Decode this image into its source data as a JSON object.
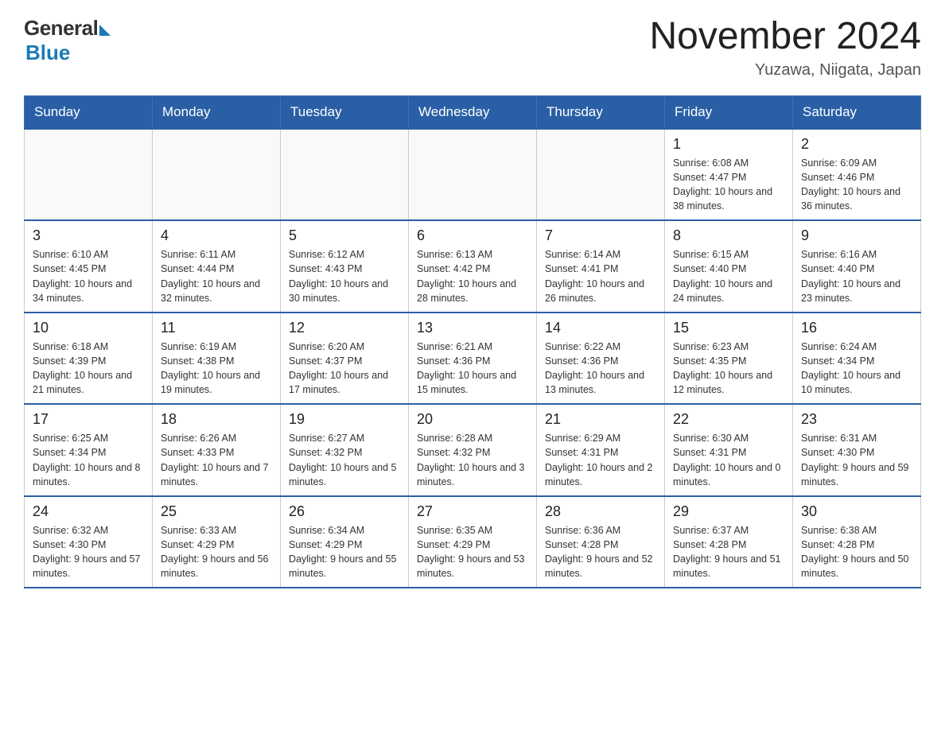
{
  "header": {
    "logo": {
      "general": "General",
      "blue": "Blue"
    },
    "title": "November 2024",
    "location": "Yuzawa, Niigata, Japan"
  },
  "weekdays": [
    "Sunday",
    "Monday",
    "Tuesday",
    "Wednesday",
    "Thursday",
    "Friday",
    "Saturday"
  ],
  "weeks": [
    [
      {
        "day": "",
        "info": ""
      },
      {
        "day": "",
        "info": ""
      },
      {
        "day": "",
        "info": ""
      },
      {
        "day": "",
        "info": ""
      },
      {
        "day": "",
        "info": ""
      },
      {
        "day": "1",
        "info": "Sunrise: 6:08 AM\nSunset: 4:47 PM\nDaylight: 10 hours and 38 minutes."
      },
      {
        "day": "2",
        "info": "Sunrise: 6:09 AM\nSunset: 4:46 PM\nDaylight: 10 hours and 36 minutes."
      }
    ],
    [
      {
        "day": "3",
        "info": "Sunrise: 6:10 AM\nSunset: 4:45 PM\nDaylight: 10 hours and 34 minutes."
      },
      {
        "day": "4",
        "info": "Sunrise: 6:11 AM\nSunset: 4:44 PM\nDaylight: 10 hours and 32 minutes."
      },
      {
        "day": "5",
        "info": "Sunrise: 6:12 AM\nSunset: 4:43 PM\nDaylight: 10 hours and 30 minutes."
      },
      {
        "day": "6",
        "info": "Sunrise: 6:13 AM\nSunset: 4:42 PM\nDaylight: 10 hours and 28 minutes."
      },
      {
        "day": "7",
        "info": "Sunrise: 6:14 AM\nSunset: 4:41 PM\nDaylight: 10 hours and 26 minutes."
      },
      {
        "day": "8",
        "info": "Sunrise: 6:15 AM\nSunset: 4:40 PM\nDaylight: 10 hours and 24 minutes."
      },
      {
        "day": "9",
        "info": "Sunrise: 6:16 AM\nSunset: 4:40 PM\nDaylight: 10 hours and 23 minutes."
      }
    ],
    [
      {
        "day": "10",
        "info": "Sunrise: 6:18 AM\nSunset: 4:39 PM\nDaylight: 10 hours and 21 minutes."
      },
      {
        "day": "11",
        "info": "Sunrise: 6:19 AM\nSunset: 4:38 PM\nDaylight: 10 hours and 19 minutes."
      },
      {
        "day": "12",
        "info": "Sunrise: 6:20 AM\nSunset: 4:37 PM\nDaylight: 10 hours and 17 minutes."
      },
      {
        "day": "13",
        "info": "Sunrise: 6:21 AM\nSunset: 4:36 PM\nDaylight: 10 hours and 15 minutes."
      },
      {
        "day": "14",
        "info": "Sunrise: 6:22 AM\nSunset: 4:36 PM\nDaylight: 10 hours and 13 minutes."
      },
      {
        "day": "15",
        "info": "Sunrise: 6:23 AM\nSunset: 4:35 PM\nDaylight: 10 hours and 12 minutes."
      },
      {
        "day": "16",
        "info": "Sunrise: 6:24 AM\nSunset: 4:34 PM\nDaylight: 10 hours and 10 minutes."
      }
    ],
    [
      {
        "day": "17",
        "info": "Sunrise: 6:25 AM\nSunset: 4:34 PM\nDaylight: 10 hours and 8 minutes."
      },
      {
        "day": "18",
        "info": "Sunrise: 6:26 AM\nSunset: 4:33 PM\nDaylight: 10 hours and 7 minutes."
      },
      {
        "day": "19",
        "info": "Sunrise: 6:27 AM\nSunset: 4:32 PM\nDaylight: 10 hours and 5 minutes."
      },
      {
        "day": "20",
        "info": "Sunrise: 6:28 AM\nSunset: 4:32 PM\nDaylight: 10 hours and 3 minutes."
      },
      {
        "day": "21",
        "info": "Sunrise: 6:29 AM\nSunset: 4:31 PM\nDaylight: 10 hours and 2 minutes."
      },
      {
        "day": "22",
        "info": "Sunrise: 6:30 AM\nSunset: 4:31 PM\nDaylight: 10 hours and 0 minutes."
      },
      {
        "day": "23",
        "info": "Sunrise: 6:31 AM\nSunset: 4:30 PM\nDaylight: 9 hours and 59 minutes."
      }
    ],
    [
      {
        "day": "24",
        "info": "Sunrise: 6:32 AM\nSunset: 4:30 PM\nDaylight: 9 hours and 57 minutes."
      },
      {
        "day": "25",
        "info": "Sunrise: 6:33 AM\nSunset: 4:29 PM\nDaylight: 9 hours and 56 minutes."
      },
      {
        "day": "26",
        "info": "Sunrise: 6:34 AM\nSunset: 4:29 PM\nDaylight: 9 hours and 55 minutes."
      },
      {
        "day": "27",
        "info": "Sunrise: 6:35 AM\nSunset: 4:29 PM\nDaylight: 9 hours and 53 minutes."
      },
      {
        "day": "28",
        "info": "Sunrise: 6:36 AM\nSunset: 4:28 PM\nDaylight: 9 hours and 52 minutes."
      },
      {
        "day": "29",
        "info": "Sunrise: 6:37 AM\nSunset: 4:28 PM\nDaylight: 9 hours and 51 minutes."
      },
      {
        "day": "30",
        "info": "Sunrise: 6:38 AM\nSunset: 4:28 PM\nDaylight: 9 hours and 50 minutes."
      }
    ]
  ]
}
